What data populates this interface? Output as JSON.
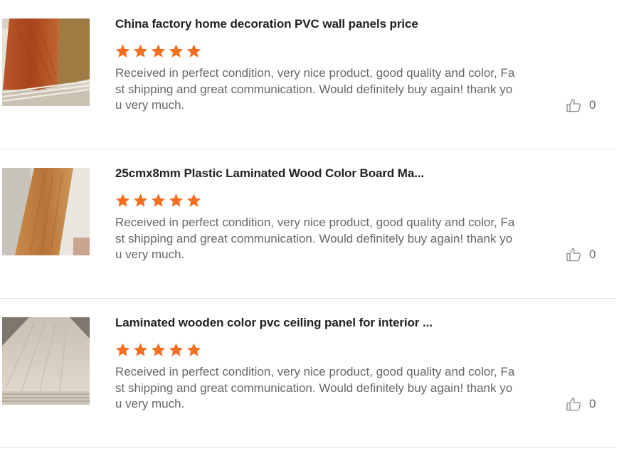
{
  "reviews": [
    {
      "product_title": "China factory home decoration PVC wall panels price",
      "rating": 5,
      "text": "Received in perfect condition, very nice product, good quality and color, Fast shipping and great communication. Would definitely buy again! thank you very much.",
      "like_count": "0",
      "image": "orange-wood-pvc-panels"
    },
    {
      "product_title": "25cmx8mm Plastic Laminated Wood Color Board Ma...",
      "rating": 5,
      "text": "Received in perfect condition, very nice product, good quality and color, Fast shipping and great communication. Would definitely buy again! thank you very much.",
      "like_count": "0",
      "image": "brown-wood-laminated-board"
    },
    {
      "product_title": "Laminated wooden color pvc ceiling panel for interior ...",
      "rating": 5,
      "text": "Received in perfect condition, very nice product, good quality and color, Fast shipping and great communication. Would definitely buy again! thank you very much.",
      "like_count": "0",
      "image": "light-wood-ceiling-panel"
    }
  ],
  "colors": {
    "star": "#f36f21",
    "divider": "#e3e3e3",
    "title": "#222222",
    "body_text": "#666666"
  },
  "icons": {
    "star": "star-icon",
    "like": "thumbs-up-icon"
  }
}
